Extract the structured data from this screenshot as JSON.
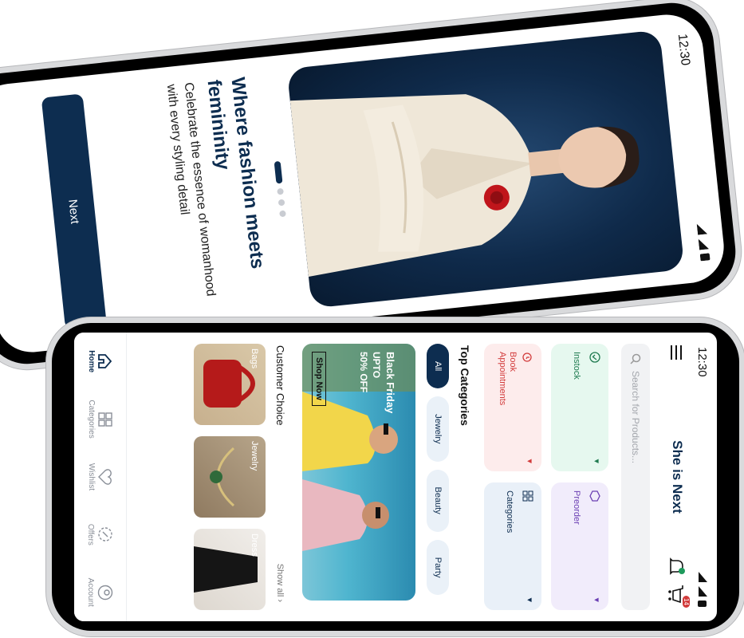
{
  "status": {
    "time": "12:30"
  },
  "onboarding": {
    "headline": "Where fashion meets femininity",
    "subtext": "Celebrate the essence of womanhood with every styling detail",
    "next_label": "Next",
    "hero_alt": "Woman in white suit with red flower brooch"
  },
  "home": {
    "app_title": "She is Next",
    "cart_count": "14",
    "search_placeholder": "Search for Products...",
    "quick_actions": [
      {
        "label": "Instock",
        "color": "#1e7a4f",
        "bg": "#e6f8ef",
        "icon": "check-circle-icon"
      },
      {
        "label": "Preorder",
        "color": "#6b3fb3",
        "bg": "#f1ecfb",
        "icon": "box-icon"
      },
      {
        "label": "Book Appointments",
        "color": "#d23b3b",
        "bg": "#fdecec",
        "icon": "alarm-icon"
      },
      {
        "label": "Categories",
        "color": "#0d2d50",
        "bg": "#e9f0f8",
        "icon": "grid-icon"
      }
    ],
    "top_categories_title": "Top Categories",
    "chips": [
      "All",
      "Jewelry",
      "Beauty",
      "Party"
    ],
    "banner": {
      "title": "Black Friday",
      "line2": "UPTO",
      "line3": "50% OFF",
      "cta": "Shop Now"
    },
    "customer_choice_title": "Customer Choice",
    "show_all": "Show all",
    "products": [
      "Bags",
      "Jewelry",
      "Dress"
    ],
    "tabbar": [
      {
        "label": "Home",
        "icon": "home-icon"
      },
      {
        "label": "Categories",
        "icon": "grid-icon"
      },
      {
        "label": "Wishlist",
        "icon": "heart-icon"
      },
      {
        "label": "Offers",
        "icon": "offer-icon"
      },
      {
        "label": "Account",
        "icon": "user-icon"
      }
    ]
  }
}
